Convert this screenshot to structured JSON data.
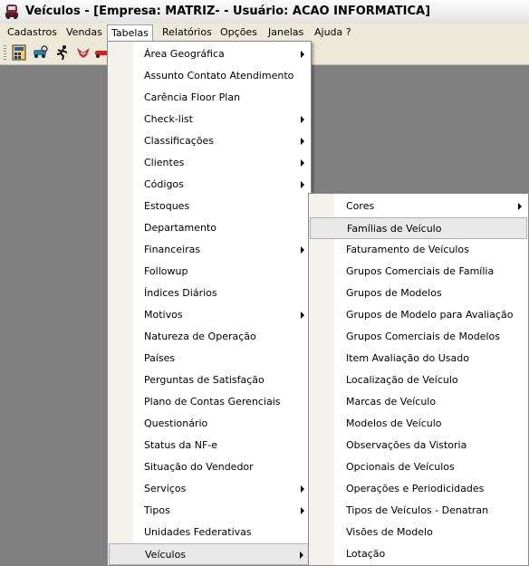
{
  "window": {
    "title": "Veículos - [Empresa: MATRIZ- - Usuário: ACAO INFORMATICA]",
    "icon": "car-app-icon"
  },
  "menubar": {
    "items": [
      {
        "label": "Cadastros"
      },
      {
        "label": "Vendas"
      },
      {
        "label": "Tabelas",
        "active": true
      },
      {
        "label": "Relatórios"
      },
      {
        "label": "Opções"
      },
      {
        "label": "Janelas"
      },
      {
        "label": "Ajuda ?"
      }
    ]
  },
  "toolbar": {
    "buttons": [
      "calculator-icon",
      "car-search-icon",
      "runner-icon",
      "bird-icon",
      "red-car-icon"
    ]
  },
  "menu_tabelas": {
    "items": [
      {
        "label": "Área Geográfica",
        "submenu": true
      },
      {
        "label": "Assunto Contato Atendimento",
        "submenu": false
      },
      {
        "label": "Carência Floor Plan",
        "submenu": false
      },
      {
        "label": "Check-list",
        "submenu": true
      },
      {
        "label": "Classificações",
        "submenu": true
      },
      {
        "label": "Clientes",
        "submenu": true
      },
      {
        "label": "Códigos",
        "submenu": true
      },
      {
        "label": "Estoques",
        "submenu": false
      },
      {
        "label": "Departamento",
        "submenu": false
      },
      {
        "label": "Financeiras",
        "submenu": true
      },
      {
        "label": "Followup",
        "submenu": false
      },
      {
        "label": "Índices Diários",
        "submenu": false
      },
      {
        "label": "Motivos",
        "submenu": true
      },
      {
        "label": "Natureza de Operação",
        "submenu": false
      },
      {
        "label": "Países",
        "submenu": false
      },
      {
        "label": "Perguntas de Satisfação",
        "submenu": false
      },
      {
        "label": "Plano de Contas Gerenciais",
        "submenu": false
      },
      {
        "label": "Questionário",
        "submenu": false
      },
      {
        "label": "Status da NF-e",
        "submenu": false
      },
      {
        "label": "Situação do Vendedor",
        "submenu": false
      },
      {
        "label": "Serviços",
        "submenu": true
      },
      {
        "label": "Tipos",
        "submenu": true
      },
      {
        "label": "Unidades Federativas",
        "submenu": false
      },
      {
        "label": "Veículos",
        "submenu": true,
        "highlighted": true
      }
    ]
  },
  "menu_veiculos": {
    "items": [
      {
        "label": "Cores",
        "submenu": true
      },
      {
        "label": "Famílias de Veículo",
        "submenu": false,
        "highlighted": true
      },
      {
        "label": "Faturamento de Veículos",
        "submenu": false
      },
      {
        "label": "Grupos Comerciais de Família",
        "submenu": false
      },
      {
        "label": "Grupos de Modelos",
        "submenu": false
      },
      {
        "label": "Grupos de Modelo para Avaliação",
        "submenu": false
      },
      {
        "label": "Grupos Comerciais de Modelos",
        "submenu": false
      },
      {
        "label": "Item Avaliação do Usado",
        "submenu": false
      },
      {
        "label": "Localização de Veículo",
        "submenu": false
      },
      {
        "label": "Marcas de Veículo",
        "submenu": false
      },
      {
        "label": "Modelos de Veículo",
        "submenu": false
      },
      {
        "label": "Observações da Vistoria",
        "submenu": false
      },
      {
        "label": "Opcionais de Veículos",
        "submenu": false
      },
      {
        "label": "Operações e Periodicidades",
        "submenu": false
      },
      {
        "label": "Tipos de Veículos - Denatran",
        "submenu": false
      },
      {
        "label": "Visões de Modelo",
        "submenu": false
      },
      {
        "label": "Lotação",
        "submenu": false
      }
    ]
  }
}
